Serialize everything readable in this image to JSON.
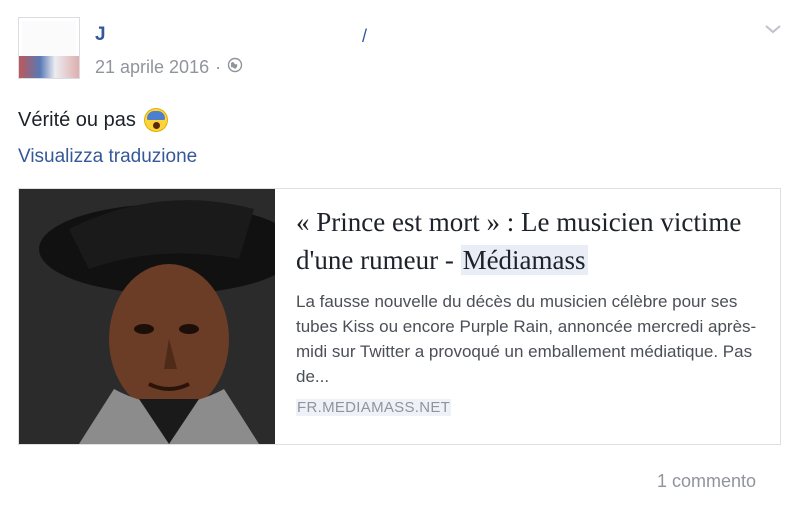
{
  "post": {
    "author_name": "J",
    "author_suffix": "/",
    "date": "21 aprile 2016",
    "separator": "·",
    "audience_icon": "globe-icon",
    "menu_icon": "chevron-down-icon",
    "text": "Vérité ou pas",
    "emoji_icon": "screaming-face-emoji",
    "translate_link": "Visualizza traduzione"
  },
  "link_card": {
    "title_main": "« Prince est mort » : Le musicien victime d'une rumeur - ",
    "title_highlight": "Médiamass",
    "description": "La fausse nouvelle du décès du musicien célèbre pour ses tubes Kiss ou encore Purple Rain, annoncée mercredi après-midi sur Twitter a provoqué un emballement médiatique. Pas de...",
    "domain": "FR.MEDIAMASS.NET"
  },
  "footer": {
    "comments": "1 commento"
  },
  "colors": {
    "link_blue": "#365899",
    "meta_gray": "#90949c",
    "text": "#1d2129",
    "highlight": "#e8edf6"
  }
}
